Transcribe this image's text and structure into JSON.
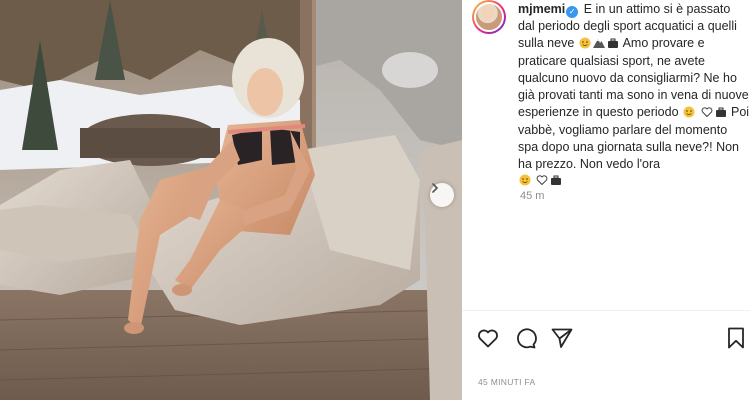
{
  "post": {
    "username": "mjmemi",
    "caption_segments": [
      "E in un attimo si è passato dal periodo degli sport acquatici a quelli sulla neve",
      "Amo provare e praticare qualsiasi sport, ne avete qualcuno nuovo da consigliarmi? Ne ho già provati tanti ma sono in vena di nuove esperienze in questo periodo",
      "Poi vabbè, vogliamo parlare del momento spa dopo una giornata sulla neve?! Non ha prezzo. Non vedo l'ora"
    ],
    "relative_time": "45 m",
    "timestamp": "45 MINUTI FA"
  },
  "icons": {
    "verified": "verified-badge-icon",
    "like": "heart-icon",
    "comment": "comment-icon",
    "share": "paper-plane-icon",
    "save": "bookmark-icon",
    "next": "chevron-right-icon"
  },
  "colors": {
    "verified_blue": "#3897f0",
    "text": "#262626",
    "muted": "#8e8e8e"
  }
}
